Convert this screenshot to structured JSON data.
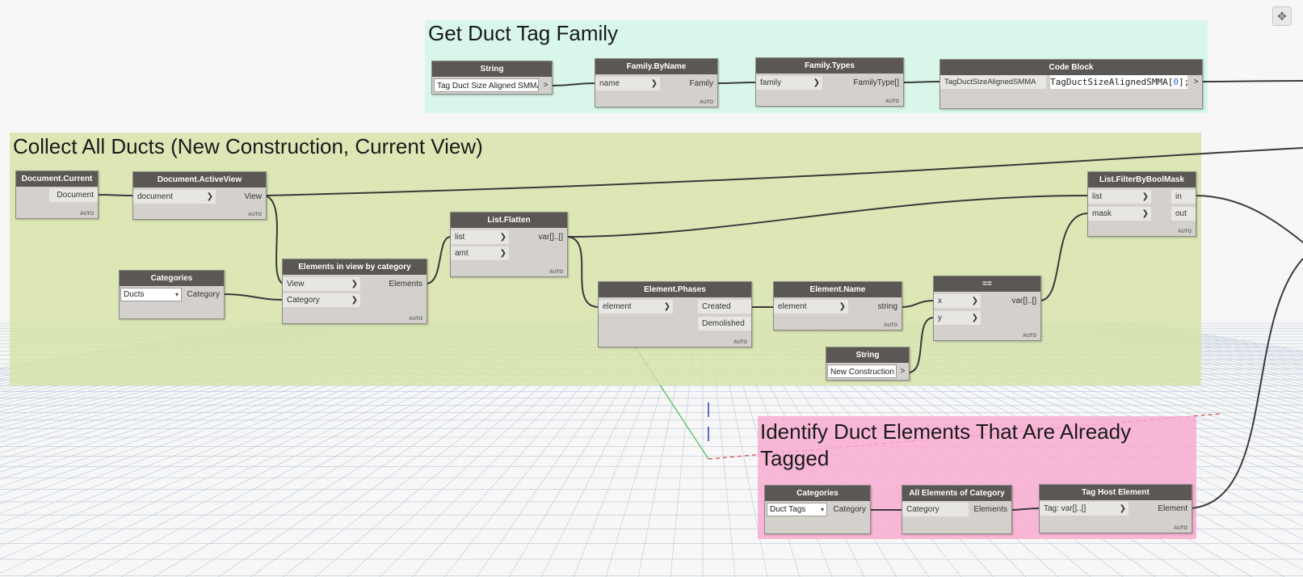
{
  "groups": {
    "tag_family": {
      "title": "Get Duct Tag Family",
      "color": "#d8f7ea"
    },
    "collect": {
      "title": "Collect All Ducts (New Construction, Current View)",
      "color": "#dde7b5"
    },
    "identify": {
      "title": "Identify Duct Elements That Are Already Tagged",
      "color": "#f8b8d6"
    }
  },
  "nodes": {
    "string1": {
      "title": "String",
      "value": "Tag Duct Size Aligned SMMA",
      "out": ">"
    },
    "family_by_name": {
      "title": "Family.ByName",
      "in": [
        "name"
      ],
      "out": [
        "Family"
      ],
      "auto": "AUTO"
    },
    "family_types": {
      "title": "Family.Types",
      "in": [
        "family"
      ],
      "out": [
        "FamilyType[]"
      ],
      "auto": "AUTO"
    },
    "code_block": {
      "title": "Code Block",
      "in_label": "TagDuctSizeAlignedSMMA",
      "code_pre": "TagDuctSizeAlignedSMMA[",
      "code_num": "0",
      "code_post": "];",
      "out": ">"
    },
    "document_current": {
      "title": "Document.Current",
      "out": [
        "Document"
      ],
      "auto": "AUTO"
    },
    "document_activeview": {
      "title": "Document.ActiveView",
      "in": [
        "document"
      ],
      "out": [
        "View"
      ],
      "auto": "AUTO"
    },
    "categories1": {
      "title": "Categories",
      "selected": "Ducts",
      "out": [
        "Category"
      ]
    },
    "elements_in_view": {
      "title": "Elements in view by category",
      "in": [
        "View",
        "Category"
      ],
      "out": [
        "Elements"
      ],
      "auto": "AUTO"
    },
    "list_flatten": {
      "title": "List.Flatten",
      "in": [
        "list",
        "amt"
      ],
      "out": [
        "var[]..[]"
      ],
      "auto": "AUTO"
    },
    "element_phases": {
      "title": "Element.Phases",
      "in": [
        "element"
      ],
      "out": [
        "Created",
        "Demolished"
      ],
      "auto": "AUTO"
    },
    "element_name": {
      "title": "Element.Name",
      "in": [
        "element"
      ],
      "out": [
        "string"
      ],
      "auto": "AUTO"
    },
    "equals": {
      "title": "==",
      "in": [
        "x",
        "y"
      ],
      "out": [
        "var[]..[]"
      ],
      "auto": "AUTO"
    },
    "string2": {
      "title": "String",
      "value": "New Construction",
      "out": ">"
    },
    "list_filter": {
      "title": "List.FilterByBoolMask",
      "in": [
        "list",
        "mask"
      ],
      "out": [
        "in",
        "out"
      ],
      "auto": "AUTO"
    },
    "categories2": {
      "title": "Categories",
      "selected": "Duct Tags",
      "out": [
        "Category"
      ]
    },
    "all_elements": {
      "title": "All Elements of Category",
      "in": [
        "Category"
      ],
      "out": [
        "Elements"
      ]
    },
    "tag_host": {
      "title": "Tag Host Element",
      "in": [
        "Tag: var[]..[]"
      ],
      "out": [
        "Element"
      ],
      "auto": "AUTO"
    }
  },
  "view_button": {
    "icon": "move-icon",
    "glyph": "✥"
  }
}
